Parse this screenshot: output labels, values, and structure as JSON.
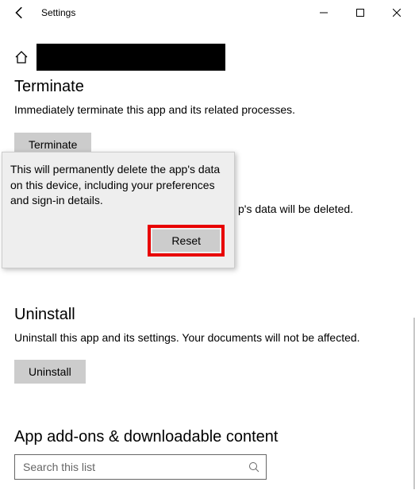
{
  "window": {
    "title": "Settings"
  },
  "sections": {
    "terminate": {
      "heading": "Terminate",
      "desc": "Immediately terminate this app and its related processes.",
      "button": "Terminate"
    },
    "reset": {
      "partial_visible_text": "p's data will be deleted.",
      "button": "Reset"
    },
    "uninstall": {
      "heading": "Uninstall",
      "desc": "Uninstall this app and its settings. Your documents will not be affected.",
      "button": "Uninstall"
    },
    "addons": {
      "heading": "App add-ons & downloadable content",
      "search_placeholder": "Search this list"
    }
  },
  "popup": {
    "text": "This will permanently delete the app's data on this device, including your preferences and sign-in details.",
    "button": "Reset"
  }
}
